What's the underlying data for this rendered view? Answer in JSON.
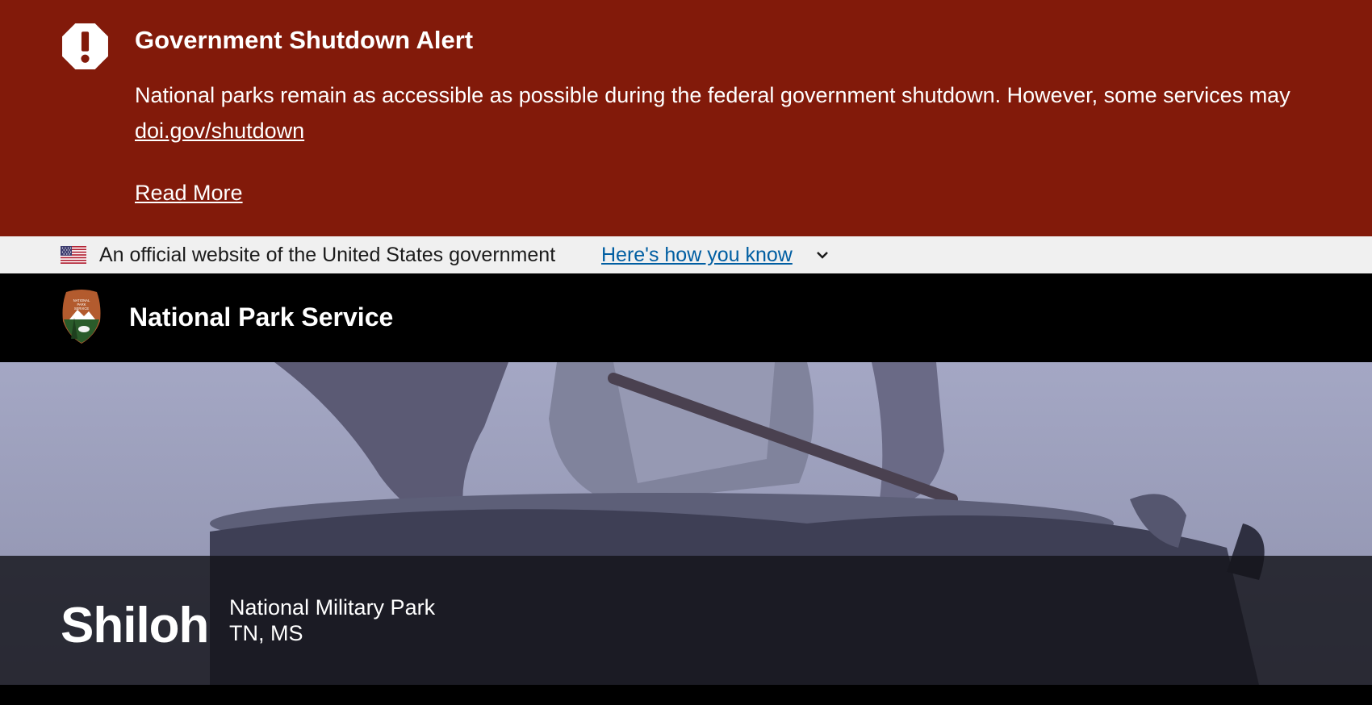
{
  "alert": {
    "icon": "exclamation-octagon-icon",
    "title": "Government Shutdown Alert",
    "body": "National parks remain as accessible as possible during the federal government shutdown. However, some services may",
    "link_text": "doi.gov/shutdown",
    "read_more": "Read More",
    "background_color": "#821a0a"
  },
  "gov_banner": {
    "icon": "us-flag-icon",
    "text": "An official website of the United States government",
    "link_text": "Here's how you know",
    "link_color": "#005ea2"
  },
  "header": {
    "logo": "nps-arrowhead-icon",
    "title": "National Park Service"
  },
  "hero": {
    "park_name": "Shiloh",
    "designation": "National Military Park",
    "states": "TN, MS"
  }
}
